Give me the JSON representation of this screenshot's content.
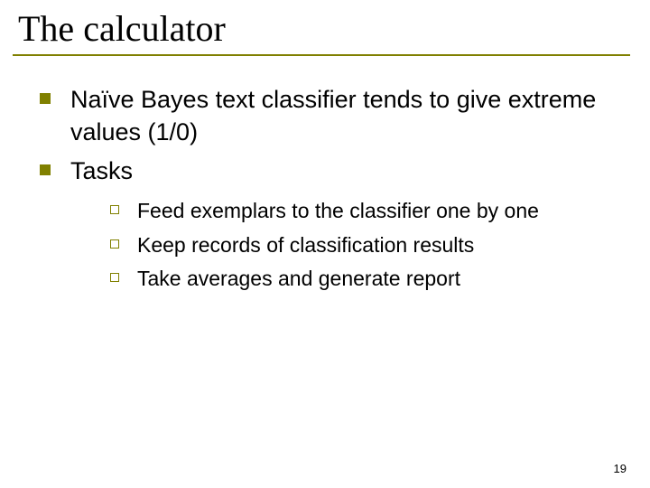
{
  "title": "The calculator",
  "bullets": [
    {
      "text": "Naïve Bayes text classifier tends to give extreme values (1/0)"
    },
    {
      "text": "Tasks"
    }
  ],
  "subbullets": [
    {
      "text": "Feed exemplars to the classifier one by one"
    },
    {
      "text": "Keep records of classification results"
    },
    {
      "text": "Take averages and generate report"
    }
  ],
  "page_number": "19"
}
